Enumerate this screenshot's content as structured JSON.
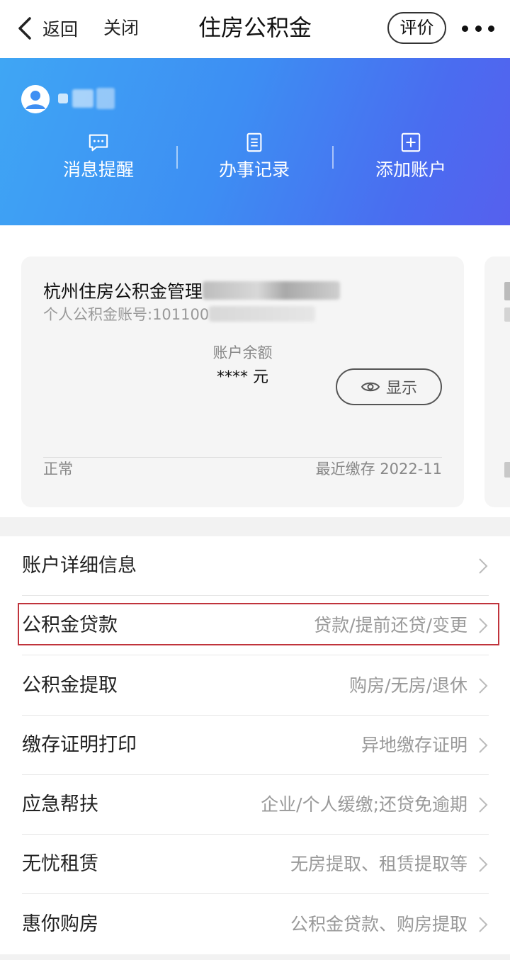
{
  "nav": {
    "back_label": "返回",
    "close_label": "关闭",
    "title": "住房公积金",
    "rate_label": "评价"
  },
  "banner": {
    "quick_actions": [
      {
        "label": "消息提醒",
        "icon": "message-icon"
      },
      {
        "label": "办事记录",
        "icon": "record-icon"
      },
      {
        "label": "添加账户",
        "icon": "add-account-icon"
      }
    ]
  },
  "card": {
    "title": "杭州住房公积金管理",
    "account": "个人公积金账号:101100",
    "balance_label": "账户余额",
    "balance_value": "**** 元",
    "show_label": "显示",
    "status": "正常",
    "recent": "最近缴存 2022-11"
  },
  "menu": [
    {
      "title": "账户详细信息",
      "sub": ""
    },
    {
      "title": "公积金贷款",
      "sub": "贷款/提前还贷/变更"
    },
    {
      "title": "公积金提取",
      "sub": "购房/无房/退休"
    },
    {
      "title": "缴存证明打印",
      "sub": "异地缴存证明"
    },
    {
      "title": "应急帮扶",
      "sub": "企业/个人缓缴;还贷免逾期"
    },
    {
      "title": "无忧租赁",
      "sub": "无房提取、租赁提取等"
    },
    {
      "title": "惠你购房",
      "sub": "公积金贷款、购房提取"
    }
  ],
  "colors": {
    "banner_start": "#3fa6f4",
    "banner_end": "#5660ee",
    "highlight": "#c0343c"
  }
}
